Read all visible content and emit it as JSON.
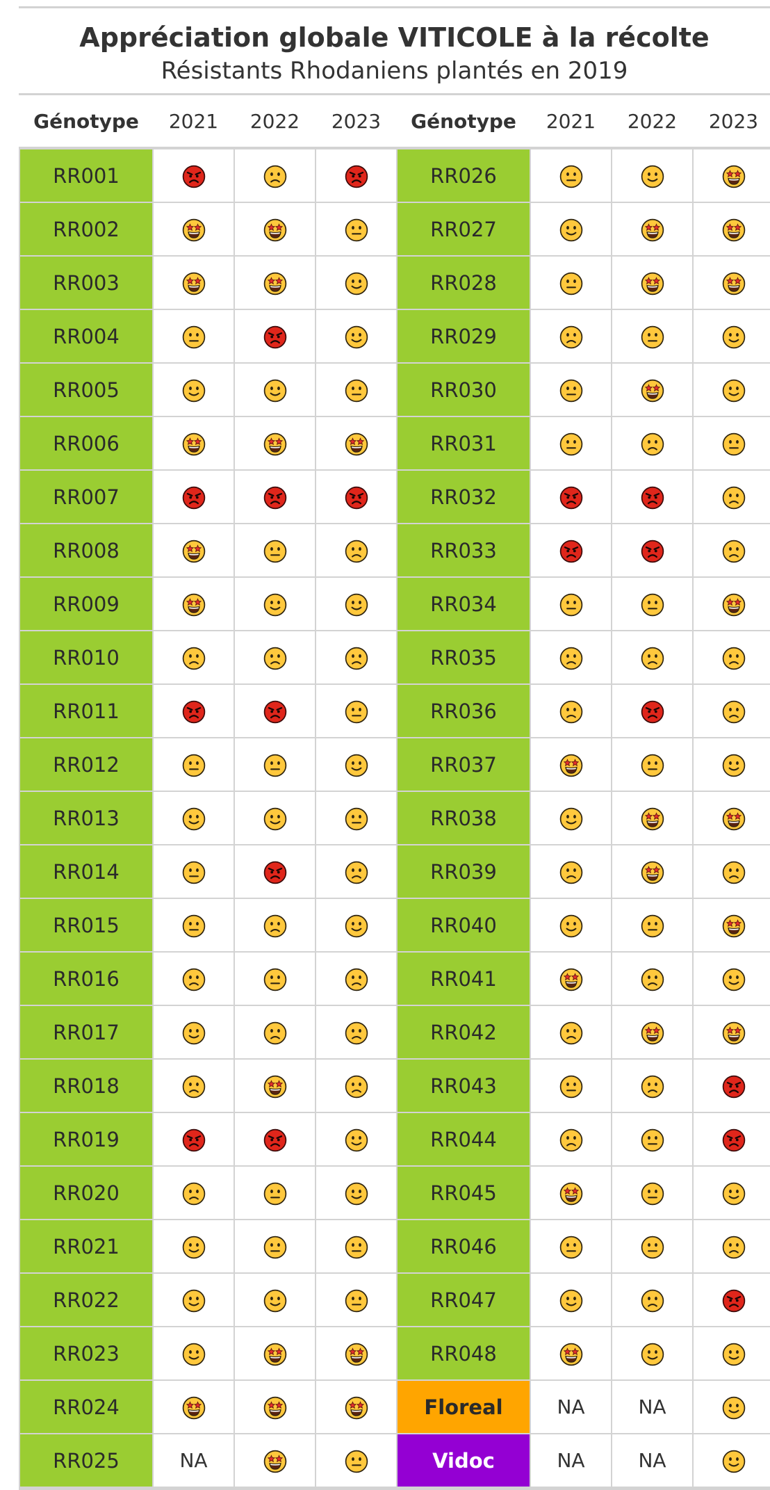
{
  "title": "Appréciation globale VITICOLE à la récolte",
  "subtitle": "Résistants Rhodaniens plantés en 2019",
  "columns": [
    "Génotype",
    "2021",
    "2022",
    "2023",
    "Génotype",
    "2021",
    "2022",
    "2023"
  ],
  "colors": {
    "genotype_bg": "#9ACD32",
    "floreal_bg": "#FFA500",
    "vidoc_bg": "#9400D3",
    "rule": "#D3D3D3"
  },
  "rating_icons": {
    "red": "angry-face-icon",
    "star": "star-struck-face-icon",
    "smile": "slightly-smiling-face-icon",
    "neutral": "neutral-face-icon",
    "sad": "slightly-frowning-face-icon"
  },
  "rows": [
    [
      {
        "g": "RR001",
        "r": [
          "red",
          "sad",
          "red"
        ]
      },
      {
        "g": "RR026",
        "r": [
          "neutral",
          "smile",
          "star"
        ]
      }
    ],
    [
      {
        "g": "RR002",
        "r": [
          "star",
          "star",
          "neutral"
        ]
      },
      {
        "g": "RR027",
        "r": [
          "smile",
          "star",
          "star"
        ]
      }
    ],
    [
      {
        "g": "RR003",
        "r": [
          "star",
          "star",
          "smile"
        ]
      },
      {
        "g": "RR028",
        "r": [
          "neutral",
          "star",
          "star"
        ]
      }
    ],
    [
      {
        "g": "RR004",
        "r": [
          "neutral",
          "red",
          "smile"
        ]
      },
      {
        "g": "RR029",
        "r": [
          "sad",
          "neutral",
          "smile"
        ]
      }
    ],
    [
      {
        "g": "RR005",
        "r": [
          "smile",
          "smile",
          "neutral"
        ]
      },
      {
        "g": "RR030",
        "r": [
          "neutral",
          "star",
          "smile"
        ]
      }
    ],
    [
      {
        "g": "RR006",
        "r": [
          "star",
          "star",
          "star"
        ]
      },
      {
        "g": "RR031",
        "r": [
          "neutral",
          "sad",
          "neutral"
        ]
      }
    ],
    [
      {
        "g": "RR007",
        "r": [
          "red",
          "red",
          "red"
        ]
      },
      {
        "g": "RR032",
        "r": [
          "red",
          "red",
          "sad"
        ]
      }
    ],
    [
      {
        "g": "RR008",
        "r": [
          "star",
          "neutral",
          "sad"
        ]
      },
      {
        "g": "RR033",
        "r": [
          "red",
          "red",
          "sad"
        ]
      }
    ],
    [
      {
        "g": "RR009",
        "r": [
          "star",
          "smile",
          "smile"
        ]
      },
      {
        "g": "RR034",
        "r": [
          "neutral",
          "neutral",
          "star"
        ]
      }
    ],
    [
      {
        "g": "RR010",
        "r": [
          "sad",
          "sad",
          "sad"
        ]
      },
      {
        "g": "RR035",
        "r": [
          "sad",
          "sad",
          "sad"
        ]
      }
    ],
    [
      {
        "g": "RR011",
        "r": [
          "red",
          "red",
          "neutral"
        ]
      },
      {
        "g": "RR036",
        "r": [
          "sad",
          "red",
          "sad"
        ]
      }
    ],
    [
      {
        "g": "RR012",
        "r": [
          "neutral",
          "neutral",
          "smile"
        ]
      },
      {
        "g": "RR037",
        "r": [
          "star",
          "neutral",
          "smile"
        ]
      }
    ],
    [
      {
        "g": "RR013",
        "r": [
          "smile",
          "smile",
          "neutral"
        ]
      },
      {
        "g": "RR038",
        "r": [
          "smile",
          "star",
          "star"
        ]
      }
    ],
    [
      {
        "g": "RR014",
        "r": [
          "neutral",
          "red",
          "sad"
        ]
      },
      {
        "g": "RR039",
        "r": [
          "sad",
          "star",
          "sad"
        ]
      }
    ],
    [
      {
        "g": "RR015",
        "r": [
          "neutral",
          "sad",
          "smile"
        ]
      },
      {
        "g": "RR040",
        "r": [
          "smile",
          "neutral",
          "star"
        ]
      }
    ],
    [
      {
        "g": "RR016",
        "r": [
          "sad",
          "neutral",
          "sad"
        ]
      },
      {
        "g": "RR041",
        "r": [
          "star",
          "sad",
          "smile"
        ]
      }
    ],
    [
      {
        "g": "RR017",
        "r": [
          "smile",
          "sad",
          "sad"
        ]
      },
      {
        "g": "RR042",
        "r": [
          "sad",
          "star",
          "star"
        ]
      }
    ],
    [
      {
        "g": "RR018",
        "r": [
          "sad",
          "star",
          "sad"
        ]
      },
      {
        "g": "RR043",
        "r": [
          "neutral",
          "sad",
          "red"
        ]
      }
    ],
    [
      {
        "g": "RR019",
        "r": [
          "red",
          "red",
          "smile"
        ]
      },
      {
        "g": "RR044",
        "r": [
          "sad",
          "neutral",
          "red"
        ]
      }
    ],
    [
      {
        "g": "RR020",
        "r": [
          "sad",
          "neutral",
          "smile"
        ]
      },
      {
        "g": "RR045",
        "r": [
          "star",
          "neutral",
          "smile"
        ]
      }
    ],
    [
      {
        "g": "RR021",
        "r": [
          "smile",
          "neutral",
          "neutral"
        ]
      },
      {
        "g": "RR046",
        "r": [
          "neutral",
          "neutral",
          "sad"
        ]
      }
    ],
    [
      {
        "g": "RR022",
        "r": [
          "smile",
          "smile",
          "neutral"
        ]
      },
      {
        "g": "RR047",
        "r": [
          "smile",
          "sad",
          "red"
        ]
      }
    ],
    [
      {
        "g": "RR023",
        "r": [
          "smile",
          "star",
          "star"
        ]
      },
      {
        "g": "RR048",
        "r": [
          "star",
          "smile",
          "smile"
        ]
      }
    ],
    [
      {
        "g": "RR024",
        "r": [
          "star",
          "star",
          "star"
        ]
      },
      {
        "g": "Floreal",
        "style": "floreal",
        "r": [
          "NA",
          "NA",
          "smile"
        ]
      }
    ],
    [
      {
        "g": "RR025",
        "r": [
          "NA",
          "star",
          "neutral"
        ]
      },
      {
        "g": "Vidoc",
        "style": "vidoc",
        "r": [
          "NA",
          "NA",
          "smile"
        ]
      }
    ]
  ]
}
